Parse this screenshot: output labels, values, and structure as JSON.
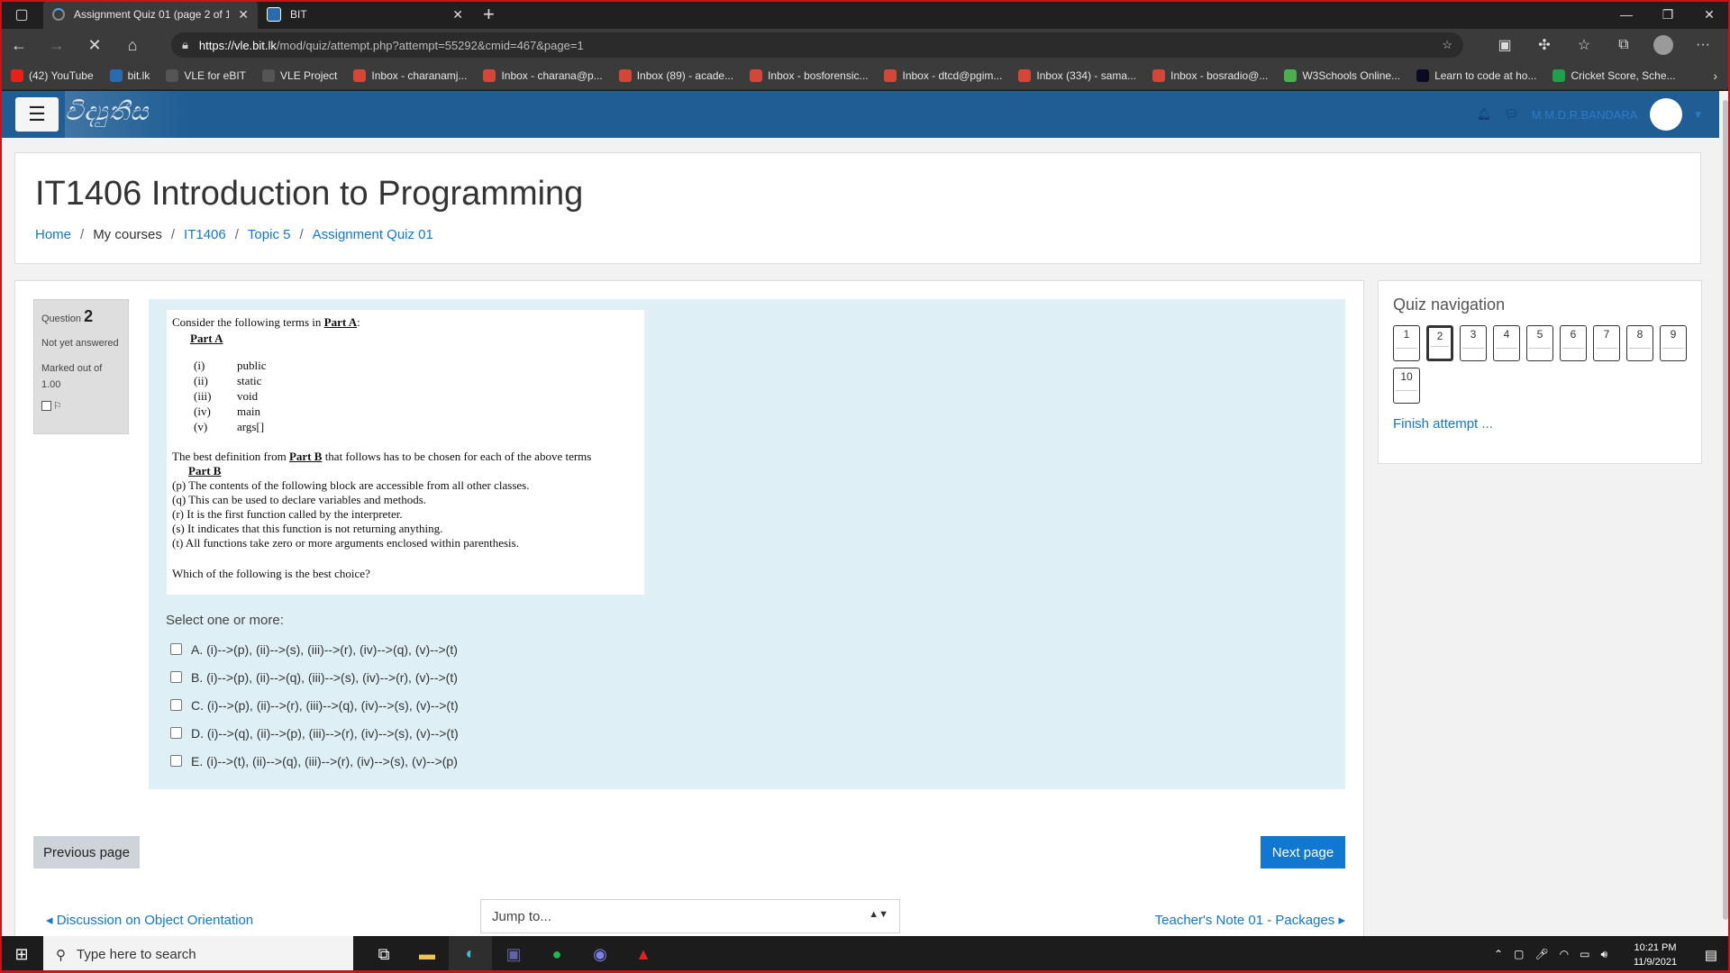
{
  "browser": {
    "tabs": [
      {
        "title": "Assignment Quiz 01 (page 2 of 1",
        "active": true
      },
      {
        "title": "BIT",
        "active": false
      }
    ],
    "url_host": "https://vle.bit.lk",
    "url_rest": "/mod/quiz/attempt.php?attempt=55292&cmid=467&page=1",
    "bookmarks": [
      {
        "label": "(42) YouTube",
        "icon": "youtube-icon",
        "color": "#e62117"
      },
      {
        "label": "bit.lk",
        "icon": "bit-icon",
        "color": "#2a6ab0"
      },
      {
        "label": "VLE for eBIT",
        "icon": "vle-icon",
        "color": "#555555"
      },
      {
        "label": "VLE Project",
        "icon": "vle-icon",
        "color": "#555555"
      },
      {
        "label": "Inbox - charanamj...",
        "icon": "gmail-icon",
        "color": "#d44638"
      },
      {
        "label": "Inbox - charana@p...",
        "icon": "gmail-icon",
        "color": "#d44638"
      },
      {
        "label": "Inbox (89) - acade...",
        "icon": "gmail-icon",
        "color": "#d44638"
      },
      {
        "label": "Inbox - bosforensic...",
        "icon": "gmail-icon",
        "color": "#d44638"
      },
      {
        "label": "Inbox - dtcd@pgim...",
        "icon": "gmail-icon",
        "color": "#d44638"
      },
      {
        "label": "Inbox (334) - sama...",
        "icon": "gmail-icon",
        "color": "#d44638"
      },
      {
        "label": "Inbox - bosradio@...",
        "icon": "gmail-icon",
        "color": "#d44638"
      },
      {
        "label": "W3Schools Online...",
        "icon": "w3schools-icon",
        "color": "#4caf50"
      },
      {
        "label": "Learn to code at ho...",
        "icon": "freecodecamp-icon",
        "color": "#0a0a23"
      },
      {
        "label": "Cricket Score, Sche...",
        "icon": "cricbuzz-icon",
        "color": "#1fa04c"
      }
    ]
  },
  "site": {
    "logo_text": "විද්‍යුතීස",
    "user_name": "M.M.D.R.BANDARA"
  },
  "header": {
    "title": "IT1406 Introduction to Programming",
    "breadcrumb": [
      "Home",
      "My courses",
      "IT1406",
      "Topic 5",
      "Assignment Quiz 01"
    ]
  },
  "question": {
    "label": "Question",
    "number": "2",
    "status": "Not yet answered",
    "marks": "Marked out of 1.00",
    "intro_a": "Consider the following terms  in ",
    "part_a_label": "Part A",
    "part_a_colon": ":",
    "terms": [
      {
        "num": "(i)",
        "term": "public"
      },
      {
        "num": "(ii)",
        "term": "static"
      },
      {
        "num": "(iii)",
        "term": "void"
      },
      {
        "num": "(iv)",
        "term": "main"
      },
      {
        "num": "(v)",
        "term": "args[]"
      }
    ],
    "intro_b_1": "The best definition from ",
    "part_b_label": "Part B",
    "intro_b_2": " that follows has to be chosen for each of the above terms",
    "definitions": [
      "(p) The contents of the following block are accessible from all other classes.",
      "(q) This can be used to declare variables and methods.",
      "(r) It is the first function called by the interpreter.",
      "(s) It indicates that this function is not returning anything.",
      "(t) All functions take zero or more arguments enclosed within parenthesis."
    ],
    "ask": "Which of the following is the best choice?",
    "prompt": "Select one or more:",
    "answers": [
      "A. (i)-->(p), (ii)-->(s), (iii)-->(r), (iv)-->(q), (v)-->(t)",
      "B. (i)-->(p), (ii)-->(q), (iii)-->(s), (iv)-->(r), (v)-->(t)",
      "C. (i)-->(p), (ii)-->(r), (iii)-->(q), (iv)-->(s), (v)-->(t)",
      "D. (i)-->(q), (ii)-->(p), (iii)-->(r), (iv)-->(s), (v)-->(t)",
      "E. (i)-->(t), (ii)-->(q), (iii)-->(r), (iv)-->(s), (v)-->(p)"
    ]
  },
  "nav": {
    "prev_label": "Previous page",
    "next_label": "Next page",
    "activity_prev": "Discussion on Object Orientation",
    "jump_label": "Jump to...",
    "activity_next": "Teacher's Note 01 - Packages"
  },
  "quiz_nav": {
    "title": "Quiz navigation",
    "buttons": [
      "1",
      "2",
      "3",
      "4",
      "5",
      "6",
      "7",
      "8",
      "9",
      "10"
    ],
    "current": "2",
    "finish_label": "Finish attempt ..."
  },
  "taskbar": {
    "search_placeholder": "Type here to search",
    "time": "10:21 PM",
    "date": "11/9/2021"
  },
  "colors": {
    "accent": "#1177d1",
    "navbar": "#1f5d94",
    "question_bg": "#deeff5"
  }
}
